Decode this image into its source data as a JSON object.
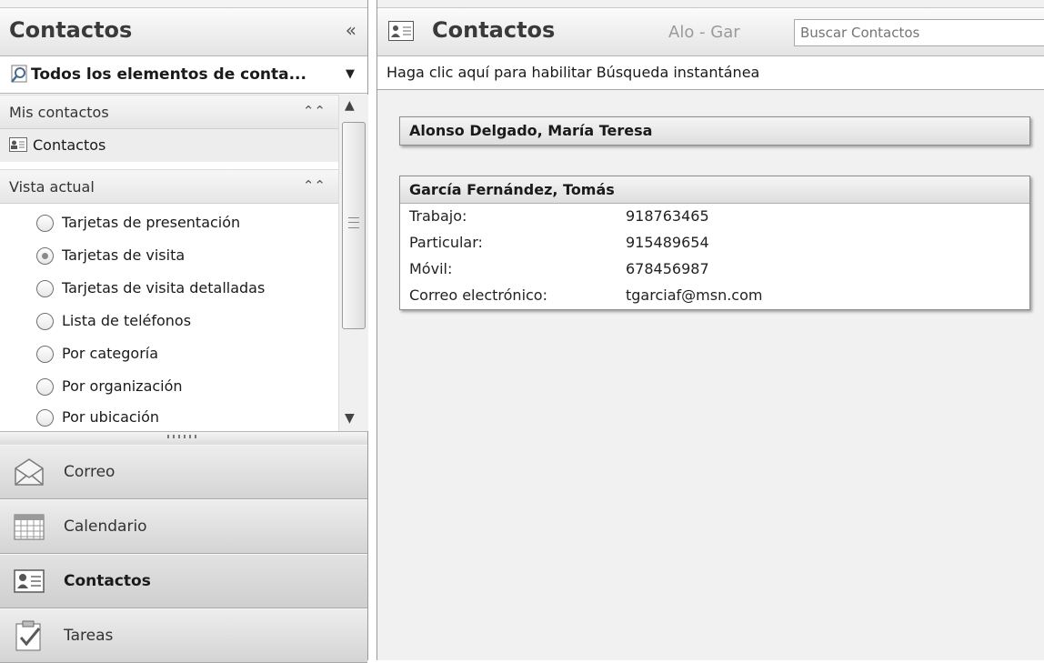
{
  "nav": {
    "title": "Contactos",
    "collapse_glyph": "«",
    "folder_dropdown": {
      "label": "Todos los elementos de conta...",
      "arrow": "▼"
    },
    "sections": {
      "mis_contactos": {
        "label": "Mis contactos",
        "items": [
          {
            "label": "Contactos",
            "icon": "contact-card-icon"
          }
        ]
      },
      "vista_actual": {
        "label": "Vista actual",
        "options": [
          {
            "label": "Tarjetas de presentación",
            "selected": false
          },
          {
            "label": "Tarjetas de visita",
            "selected": true
          },
          {
            "label": "Tarjetas de visita detalladas",
            "selected": false
          },
          {
            "label": "Lista de teléfonos",
            "selected": false
          },
          {
            "label": "Por categoría",
            "selected": false
          },
          {
            "label": "Por organización",
            "selected": false
          },
          {
            "label": "Por ubicación",
            "selected": false
          }
        ]
      }
    },
    "buttons": [
      {
        "label": "Correo",
        "icon": "envelope-icon",
        "active": false
      },
      {
        "label": "Calendario",
        "icon": "calendar-icon",
        "active": false
      },
      {
        "label": "Contactos",
        "icon": "contacts-icon",
        "active": true
      },
      {
        "label": "Tareas",
        "icon": "tasks-icon",
        "active": false
      }
    ]
  },
  "main": {
    "title": "Contactos",
    "range": "Alo - Gar",
    "search": {
      "placeholder": "Buscar Contactos",
      "value": ""
    },
    "instant_search_bar": "Haga clic aquí para habilitar Búsqueda instantánea",
    "cards": [
      {
        "name": "Alonso Delgado, María Teresa",
        "fields": []
      },
      {
        "name": "García Fernández, Tomás",
        "fields": [
          {
            "label": "Trabajo:",
            "value": "918763465"
          },
          {
            "label": "Particular:",
            "value": "915489654"
          },
          {
            "label": "Móvil:",
            "value": "678456987"
          },
          {
            "label": "Correo electrónico:",
            "value": "tgarciaf@msn.com"
          }
        ]
      }
    ]
  }
}
